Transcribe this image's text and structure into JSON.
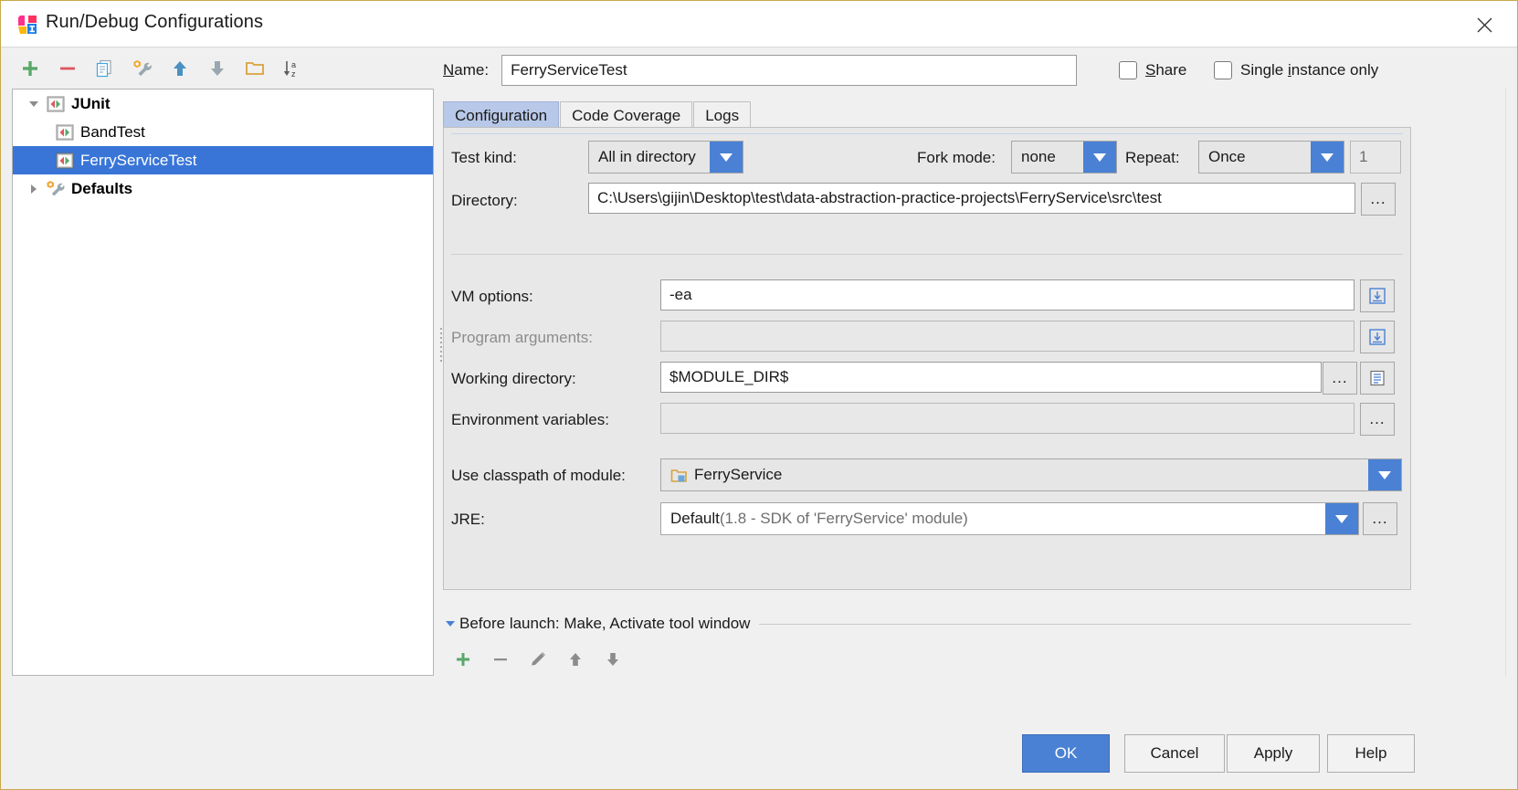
{
  "window": {
    "title": "Run/Debug Configurations",
    "app_icon": "intellij-idea-icon",
    "close_label": "✕"
  },
  "toolbar": {
    "buttons": [
      {
        "name": "add-configuration-button",
        "icon": "plus-icon",
        "tooltip": "Add New Configuration"
      },
      {
        "name": "remove-configuration-button",
        "icon": "minus-icon",
        "tooltip": "Remove Configuration"
      },
      {
        "name": "copy-configuration-button",
        "icon": "copy-icon",
        "tooltip": "Copy Configuration"
      },
      {
        "name": "edit-defaults-button",
        "icon": "wrench-icon",
        "tooltip": "Edit defaults"
      },
      {
        "name": "move-up-button",
        "icon": "arrow-up-icon",
        "tooltip": "Move Up"
      },
      {
        "name": "move-down-button",
        "icon": "arrow-down-icon",
        "tooltip": "Move Down"
      },
      {
        "name": "create-folder-button",
        "icon": "folder-icon",
        "tooltip": "Create New Folder"
      },
      {
        "name": "sort-button",
        "icon": "sort-az-icon",
        "tooltip": "Sort Configurations"
      }
    ]
  },
  "tree": {
    "items": [
      {
        "label": "JUnit",
        "icon": "junit-icon",
        "level": 0,
        "bold": true,
        "expanded": true,
        "has_toggle": true,
        "selected": false
      },
      {
        "label": "BandTest",
        "icon": "junit-icon",
        "level": 1,
        "bold": false,
        "expanded": false,
        "has_toggle": false,
        "selected": false
      },
      {
        "label": "FerryServiceTest",
        "icon": "junit-icon",
        "level": 1,
        "bold": false,
        "expanded": false,
        "has_toggle": false,
        "selected": true
      },
      {
        "label": "Defaults",
        "icon": "wrench-icon",
        "level": 0,
        "bold": true,
        "expanded": false,
        "has_toggle": true,
        "selected": false
      }
    ]
  },
  "name_row": {
    "label": "Name:",
    "label_mnemonic": "N",
    "label_rest": "ame:",
    "value": "FerryServiceTest",
    "share": {
      "label": "Share",
      "mnemonic": "S",
      "rest": "hare",
      "checked": false
    },
    "single_instance": {
      "label": "Single instance only",
      "prefix": "Single ",
      "mnemonic": "i",
      "rest": "nstance only",
      "checked": false
    }
  },
  "tabs": [
    {
      "label": "Configuration",
      "active": true
    },
    {
      "label": "Code Coverage",
      "active": false
    },
    {
      "label": "Logs",
      "active": false
    }
  ],
  "config": {
    "test_kind": {
      "label_mn": "T",
      "label_rest": "est kind:",
      "value": "All in directory"
    },
    "fork_mode": {
      "label_mn": "F",
      "label_rest": "ork mode:",
      "value": "none"
    },
    "repeat": {
      "label_mn": "R",
      "label_rest": "epeat:",
      "value": "Once",
      "count": "1"
    },
    "directory": {
      "label": "Directory:",
      "value": "C:\\Users\\gijin\\Desktop\\test\\data-abstraction-practice-projects\\FerryService\\src\\test",
      "browse_label": "..."
    },
    "vm_options": {
      "label_mn": "V",
      "label_rest": "M options:",
      "value": "-ea",
      "expand_icon": "expand-editor-icon"
    },
    "program_arguments": {
      "label_prefix": "Program a",
      "label_mn": "r",
      "label_rest": "guments:",
      "value": "",
      "disabled": true,
      "expand_icon": "expand-editor-icon"
    },
    "working_directory": {
      "label_mn": "W",
      "label_rest": "orking directory:",
      "value": "$MODULE_DIR$",
      "browse_label": "...",
      "macro_icon": "macros-icon"
    },
    "environment_variables": {
      "label_mn": "E",
      "label_rest": "nvironment variables:",
      "value": "",
      "disabled": true,
      "browse_label": "..."
    },
    "classpath_module": {
      "label_prefix": "Use classpath of m",
      "label_mn": "o",
      "label_rest": "dule:",
      "value": "FerryService",
      "icon": "module-icon"
    },
    "jre": {
      "label_mn": "J",
      "label_rest": "RE:",
      "value": "Default",
      "value_sub": " (1.8 - SDK of 'FerryService' module)",
      "browse_label": "..."
    }
  },
  "before_launch": {
    "prefix": "B",
    "mnemonic_rest": "efore launch: Make, Activate tool window",
    "full": "Before launch: Make, Activate tool window",
    "expanded": true,
    "buttons": [
      {
        "name": "before-launch-add-button",
        "icon": "plus-icon"
      },
      {
        "name": "before-launch-remove-button",
        "icon": "minus-icon"
      },
      {
        "name": "before-launch-edit-button",
        "icon": "pencil-icon"
      },
      {
        "name": "before-launch-move-up-button",
        "icon": "arrow-up-icon"
      },
      {
        "name": "before-launch-move-down-button",
        "icon": "arrow-down-icon"
      }
    ]
  },
  "footer": {
    "ok": "OK",
    "cancel": "Cancel",
    "apply": "Apply",
    "help": "Help"
  },
  "colors": {
    "accent_blue": "#4a81d4",
    "selection_blue": "#3875d7",
    "tab_active": "#b7c8e8",
    "panel_bg": "#e8e8e8",
    "window_bg": "#f0f0f0"
  }
}
